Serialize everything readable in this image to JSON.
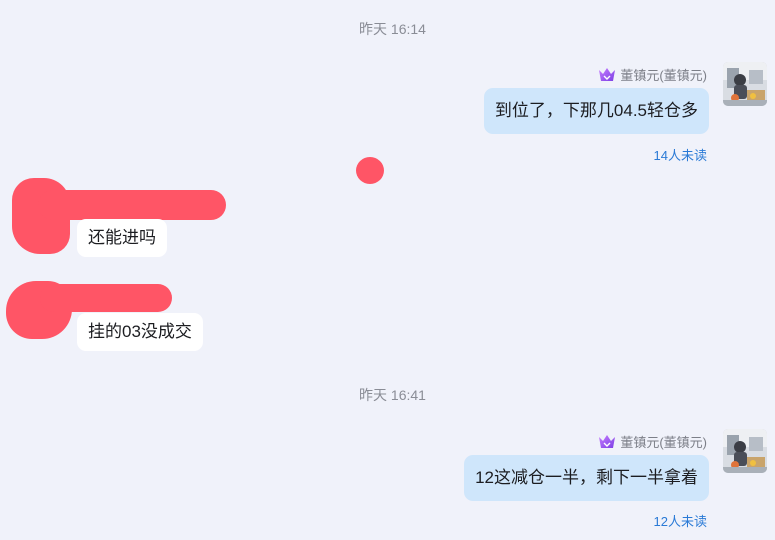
{
  "colors": {
    "background": "#f0f2fa",
    "outgoing_bubble": "#cfe6fb",
    "incoming_bubble": "#ffffff",
    "unread_text": "#2a7ad6",
    "redaction": "#ff5566",
    "crown_icon": "#9b5de5"
  },
  "messages": [
    {
      "timestamp": "昨天 16:14",
      "sender": "董镇元(董镇元)",
      "text": "到位了，下那几04.5轻仓多",
      "unread": "14人未读",
      "direction": "outgoing"
    },
    {
      "text": "还能进吗",
      "direction": "incoming"
    },
    {
      "text": "挂的03没成交",
      "direction": "incoming"
    },
    {
      "timestamp": "昨天 16:41",
      "sender": "董镇元(董镇元)",
      "text": "12这减仓一半，剩下一半拿着",
      "unread": "12人未读",
      "direction": "outgoing"
    }
  ],
  "icons": {
    "sender_badge": "crown-icon",
    "avatar": "user-avatar-photo"
  }
}
